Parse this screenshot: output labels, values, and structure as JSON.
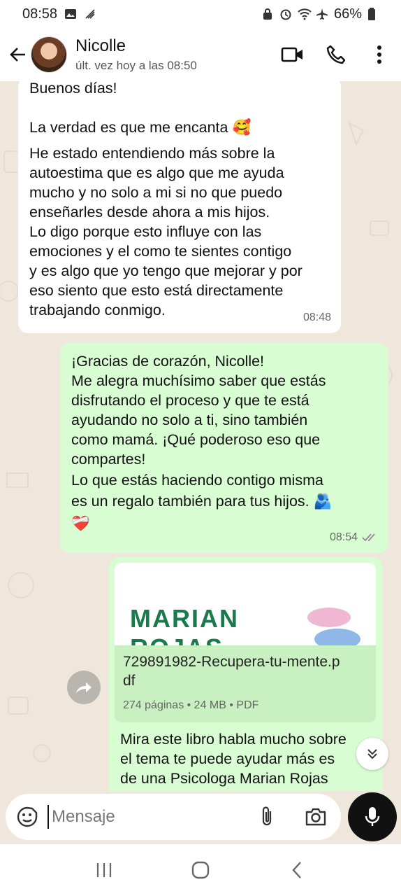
{
  "status_bar": {
    "time": "08:58",
    "battery": "66%",
    "left_icons": [
      "image-icon",
      "data-icon"
    ],
    "right_icons": [
      "lock-icon",
      "alarm-icon",
      "wifi-icon",
      "airplane-icon",
      "battery-icon"
    ]
  },
  "header": {
    "contact_name": "Nicolle",
    "last_seen": "últ. vez hoy a las 08:50",
    "actions": [
      "video-call-icon",
      "phone-icon",
      "more-icon"
    ]
  },
  "messages": [
    {
      "direction": "incoming",
      "lines": [
        "Buenos días!",
        "",
        "La verdad es que me encanta 🥰",
        "He estado entendiendo más sobre la",
        "autoestima que es algo que me ayuda",
        "mucho y no solo a mi si no que puedo",
        "enseñarles desde ahora a mis hijos.",
        "Lo digo porque esto influye con las",
        "emociones y el como te sientes contigo",
        "y es algo que yo tengo que mejorar y por",
        "eso siento que esto está directamente",
        "trabajando conmigo."
      ],
      "time": "08:48"
    },
    {
      "direction": "outgoing",
      "lines": [
        "¡Gracias de corazón, Nicolle!",
        "Me alegra muchísimo saber que estás",
        "disfrutando el proceso y que te está",
        "ayudando no solo a ti, sino también",
        "como mamá. ¡Qué poderoso eso que",
        "compartes!",
        "Lo que estás haciendo contigo misma",
        "es un regalo también para tus hijos. 🫂",
        "❤️‍🩹"
      ],
      "time": "08:54",
      "ticks": "read"
    },
    {
      "direction": "outgoing",
      "type": "document",
      "preview_text": [
        "MARIAN",
        "ROJAS"
      ],
      "file_name": "729891982-Recupera-tu-mente.pdf",
      "file_name_lines": [
        "729891982-Recupera-tu-mente.p",
        "df"
      ],
      "file_meta": "274 páginas • 24 MB • PDF",
      "caption_lines": [
        "Mira este libro habla mucho sobre",
        "el tema te puede ayudar más es",
        "de una Psicologa Marian Rojas"
      ]
    }
  ],
  "composer": {
    "placeholder": "Mensaje"
  },
  "colors": {
    "chat_bg": "#efe7dc",
    "incoming_bubble": "#ffffff",
    "outgoing_bubble": "#d9fdd3",
    "read_ticks": "#8a8a8a",
    "brand_green": "#1a7a4c"
  }
}
